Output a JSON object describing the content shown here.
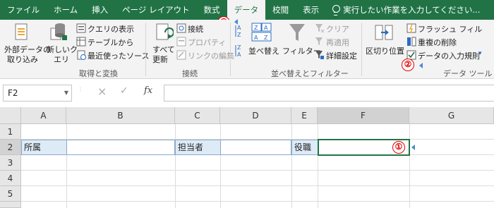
{
  "ribbon_tabs": [
    "ファイル",
    "ホーム",
    "挿入",
    "ページ レイアウト",
    "数式",
    "データ",
    "校閲",
    "表示"
  ],
  "active_tab": "データ",
  "tell_me": "実行したい作業を入力してください...",
  "groups": {
    "get_transform": {
      "label": "取得と変換",
      "external_data_line1": "外部データの",
      "external_data_line2": "取り込み",
      "new_query_line1": "新しいク",
      "new_query_line2": "エリ",
      "show_queries": "クエリの表示",
      "from_table": "テーブルから",
      "recent_sources": "最近使ったソース"
    },
    "connections": {
      "label": "接続",
      "refresh_line1": "すべて",
      "refresh_line2": "更新",
      "connections": "接続",
      "properties": "プロパティ",
      "edit_links": "リンクの編集"
    },
    "sort_filter": {
      "label": "並べ替えとフィルター",
      "sort": "並べ替え",
      "filter": "フィルター",
      "clear": "クリア",
      "reapply": "再適用",
      "advanced": "詳細設定"
    },
    "data_tools": {
      "label": "データ ツール",
      "text_to_columns": "区切り位置",
      "flash_fill": "フラッシュ フィル",
      "remove_duplicates": "重複の削除",
      "data_validation": "データの入力規則"
    }
  },
  "formula_bar": {
    "name_box": "F2",
    "cancel": "×",
    "enter": "✓",
    "fx": "fx",
    "value": ""
  },
  "columns": [
    "A",
    "B",
    "C",
    "D",
    "E",
    "F",
    "G"
  ],
  "rows": [
    "1",
    "2",
    "3",
    "4",
    "5"
  ],
  "cells": {
    "A2": "所属",
    "C2": "担当者",
    "E2": "役職"
  },
  "markers": {
    "one": "①",
    "two": "②",
    "three": "③"
  },
  "colors": {
    "brand": "#217346",
    "marker": "#e00000",
    "label_fill": "#ddebf7"
  }
}
